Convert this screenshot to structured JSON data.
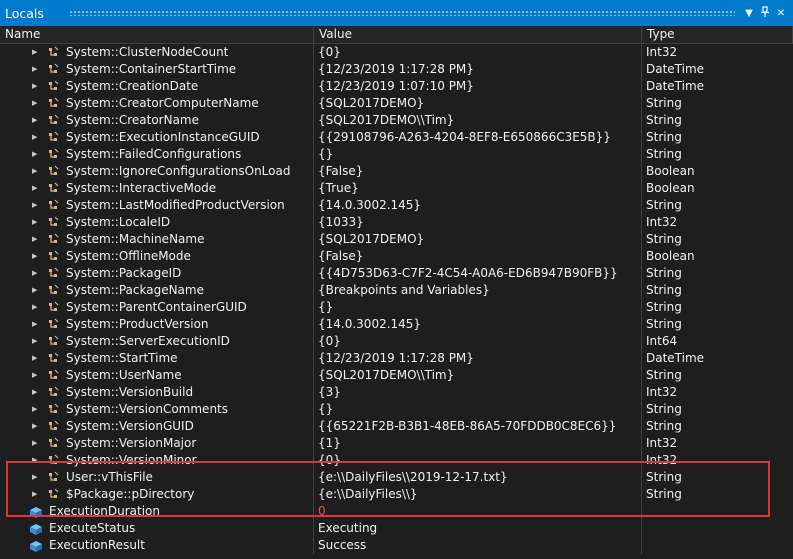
{
  "window": {
    "title": "Locals"
  },
  "columns": {
    "name": "Name",
    "value": "Value",
    "type": "Type"
  },
  "variables": [
    {
      "name": "System::ClusterNodeCount",
      "value": "{0}",
      "type": "Int32"
    },
    {
      "name": "System::ContainerStartTime",
      "value": "{12/23/2019 1:17:28 PM}",
      "type": "DateTime"
    },
    {
      "name": "System::CreationDate",
      "value": "{12/23/2019 1:07:10 PM}",
      "type": "DateTime"
    },
    {
      "name": "System::CreatorComputerName",
      "value": "{SQL2017DEMO}",
      "type": "String"
    },
    {
      "name": "System::CreatorName",
      "value": "{SQL2017DEMO\\\\Tim}",
      "type": "String"
    },
    {
      "name": "System::ExecutionInstanceGUID",
      "value": "{{29108796-A263-4204-8EF8-E650866C3E5B}}",
      "type": "String"
    },
    {
      "name": "System::FailedConfigurations",
      "value": "{}",
      "type": "String"
    },
    {
      "name": "System::IgnoreConfigurationsOnLoad",
      "value": "{False}",
      "type": "Boolean"
    },
    {
      "name": "System::InteractiveMode",
      "value": "{True}",
      "type": "Boolean"
    },
    {
      "name": "System::LastModifiedProductVersion",
      "value": "{14.0.3002.145}",
      "type": "String"
    },
    {
      "name": "System::LocaleID",
      "value": "{1033}",
      "type": "Int32"
    },
    {
      "name": "System::MachineName",
      "value": "{SQL2017DEMO}",
      "type": "String"
    },
    {
      "name": "System::OfflineMode",
      "value": "{False}",
      "type": "Boolean"
    },
    {
      "name": "System::PackageID",
      "value": "{{4D753D63-C7F2-4C54-A0A6-ED6B947B90FB}}",
      "type": "String"
    },
    {
      "name": "System::PackageName",
      "value": "{Breakpoints and Variables}",
      "type": "String"
    },
    {
      "name": "System::ParentContainerGUID",
      "value": "{}",
      "type": "String"
    },
    {
      "name": "System::ProductVersion",
      "value": "{14.0.3002.145}",
      "type": "String"
    },
    {
      "name": "System::ServerExecutionID",
      "value": "{0}",
      "type": "Int64"
    },
    {
      "name": "System::StartTime",
      "value": "{12/23/2019 1:17:28 PM}",
      "type": "DateTime"
    },
    {
      "name": "System::UserName",
      "value": "{SQL2017DEMO\\\\Tim}",
      "type": "String"
    },
    {
      "name": "System::VersionBuild",
      "value": "{3}",
      "type": "Int32"
    },
    {
      "name": "System::VersionComments",
      "value": "{}",
      "type": "String"
    },
    {
      "name": "System::VersionGUID",
      "value": "{{65221F2B-B3B1-48EB-86A5-70FDDB0C8EC6}}",
      "type": "String"
    },
    {
      "name": "System::VersionMajor",
      "value": "{1}",
      "type": "Int32"
    },
    {
      "name": "System::VersionMinor",
      "value": "{0}",
      "type": "Int32"
    },
    {
      "name": "User::vThisFile",
      "value": "{e:\\\\DailyFiles\\\\2019-12-17.txt}",
      "type": "String"
    },
    {
      "name": "$Package::pDirectory",
      "value": "{e:\\\\DailyFiles\\\\}",
      "type": "String"
    }
  ],
  "plain_rows": [
    {
      "name": "ExecutionDuration",
      "value": "0",
      "type": ""
    },
    {
      "name": "ExecuteStatus",
      "value": "Executing",
      "type": ""
    },
    {
      "name": "ExecutionResult",
      "value": "Success",
      "type": ""
    }
  ],
  "colors": {
    "accent": "#007acc",
    "highlight": "#e0353b",
    "changed_value": "#f14c4c",
    "icon": "#dcb67a"
  }
}
